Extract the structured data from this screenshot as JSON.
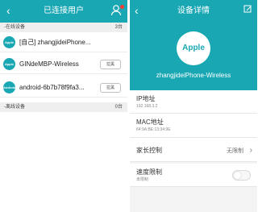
{
  "left_panel": {
    "title": "已连接用户",
    "online_section": {
      "label": "-在线设备",
      "count": "3台"
    },
    "devices": [
      {
        "avatar": "Apple",
        "name": "[自己] zhangjideiPhone..."
      },
      {
        "avatar": "Apple",
        "name": "GINdeMBP-Wireless",
        "action": "拉黑"
      },
      {
        "avatar": "Android",
        "name": "android-6b7b78f9fa3...",
        "action": "拉黑"
      }
    ],
    "offline_section": {
      "label": "-离线设备",
      "count": "0台"
    }
  },
  "right_panel": {
    "title": "设备详情",
    "logo": "Apple",
    "device_name": "zhangjideiPhone-Wireless",
    "ip": {
      "label": "IP地址",
      "value": "192.168.3.2"
    },
    "mac": {
      "label": "MAC地址",
      "value": "64:9A:BE:13:34:9E"
    },
    "parental_control": {
      "label": "家长控制",
      "value": "无限制"
    },
    "speed_limit": {
      "label": "速度限制",
      "value": "未限制",
      "enabled": false
    }
  },
  "colors": {
    "accent": "#1aa7b4",
    "alert": "#ff3b30"
  },
  "icons": {
    "back": "chevron-left-icon",
    "user": "user-icon",
    "edit": "edit-icon",
    "chevron": "chevron-right-icon"
  }
}
